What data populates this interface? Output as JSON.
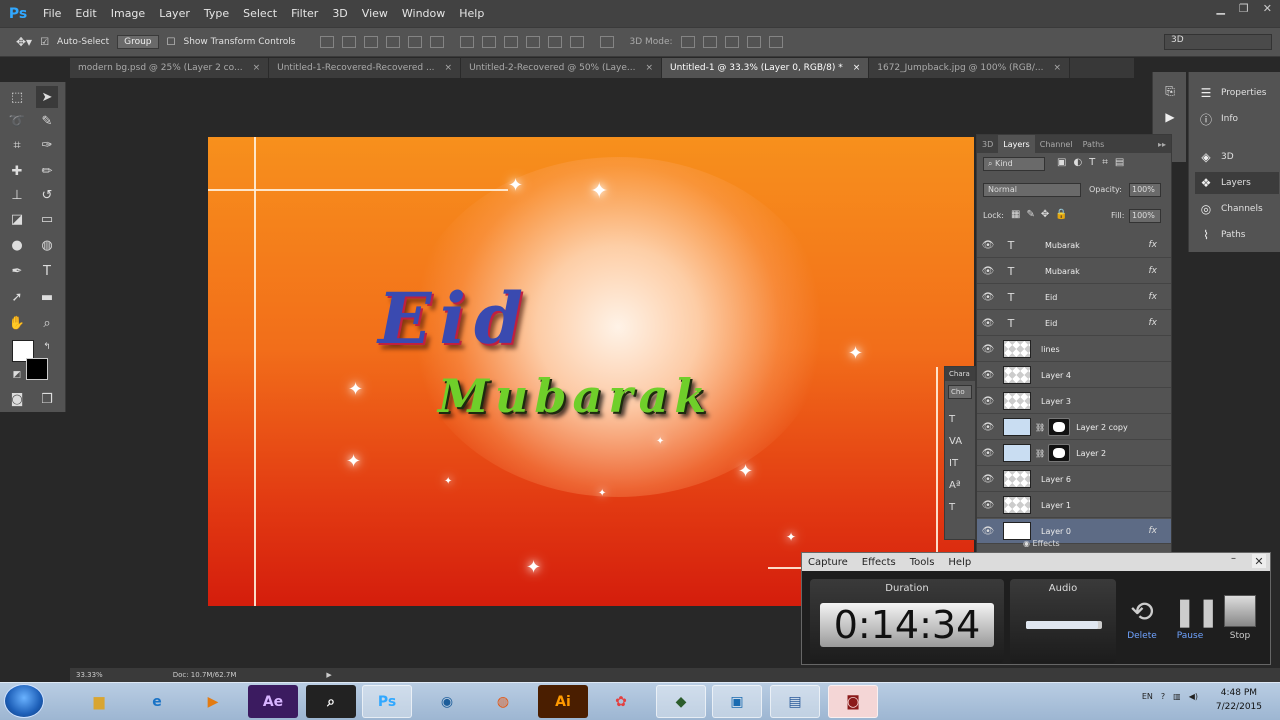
{
  "app": {
    "logo": "Ps"
  },
  "menu": [
    "File",
    "Edit",
    "Image",
    "Layer",
    "Type",
    "Select",
    "Filter",
    "3D",
    "View",
    "Window",
    "Help"
  ],
  "options": {
    "auto_select": "Auto-Select",
    "group": "Group",
    "show_transform": "Show Transform Controls",
    "mode_3d": "3D Mode:",
    "workspace": "3D"
  },
  "tabs": [
    {
      "label": "modern bg.psd @ 25% (Layer 2 co...",
      "active": false
    },
    {
      "label": "Untitled-1-Recovered-Recovered ...",
      "active": false
    },
    {
      "label": "Untitled-2-Recovered @ 50% (Laye...",
      "active": false
    },
    {
      "label": "Untitled-1 @ 33.3% (Layer 0, RGB/8) *",
      "active": true
    },
    {
      "label": "1672_Jumpback.jpg @ 100% (RGB/...",
      "active": false
    }
  ],
  "canvas": {
    "eid": "Eid",
    "mubarak": "Mubarak",
    "colors": {
      "top": "#f7901c",
      "bottom": "#d41d0c"
    }
  },
  "rail": {
    "properties": "Properties",
    "info": "Info",
    "threed": "3D",
    "layers": "Layers",
    "channels": "Channels",
    "paths": "Paths"
  },
  "layers_panel": {
    "tabs": [
      "3D",
      "Layers",
      "Channel",
      "Paths"
    ],
    "kind": "Kind",
    "blend": "Normal",
    "opacity_label": "Opacity:",
    "opacity": "100%",
    "lock_label": "Lock:",
    "fill_label": "Fill:",
    "fill": "100%",
    "rows": [
      {
        "name": "Mubarak",
        "type": "text",
        "fx": true
      },
      {
        "name": "Mubarak",
        "type": "text",
        "fx": true
      },
      {
        "name": "Eid",
        "type": "text",
        "fx": true
      },
      {
        "name": "Eid",
        "type": "text",
        "fx": true
      },
      {
        "name": "lines",
        "type": "raster",
        "fx": false
      },
      {
        "name": "Layer 4",
        "type": "raster",
        "fx": false
      },
      {
        "name": "Layer 3",
        "type": "raster",
        "fx": false
      },
      {
        "name": "Layer 2 copy",
        "type": "masked",
        "fx": false
      },
      {
        "name": "Layer 2",
        "type": "masked",
        "fx": false
      },
      {
        "name": "Layer 6",
        "type": "raster",
        "fx": false
      },
      {
        "name": "Layer 1",
        "type": "raster",
        "fx": false
      },
      {
        "name": "Layer 0",
        "type": "raster",
        "fx": true,
        "selected": true
      }
    ],
    "effects": "Effects"
  },
  "char_panel": {
    "title": "Chara",
    "field": "Cho"
  },
  "recorder": {
    "menu": [
      "Capture",
      "Effects",
      "Tools",
      "Help"
    ],
    "duration_label": "Duration",
    "duration": "0:14:34",
    "audio_label": "Audio",
    "audio_level": 0.95,
    "buttons": {
      "delete": "Delete",
      "pause": "Pause",
      "stop": "Stop"
    }
  },
  "status": {
    "zoom": "33.33%",
    "doc": "Doc: 10.7M/62.7M"
  },
  "taskbar": {
    "time": "4:48 PM",
    "date": "7/22/2015",
    "lang": "EN"
  }
}
